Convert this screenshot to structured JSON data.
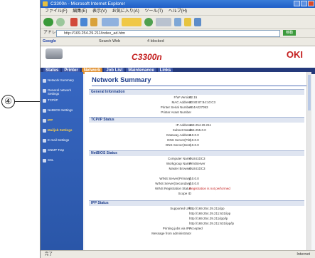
{
  "annotation": {
    "number": "④"
  },
  "window": {
    "title": "C3300n - Microsoft Internet Explorer"
  },
  "menu": [
    "ファイル(F)",
    "編集(E)",
    "表示(V)",
    "お気に入り(A)",
    "ツール(T)",
    "ヘルプ(H)"
  ],
  "address": {
    "label": "アドレス(D)",
    "url": "http://169.254.29.211/index_ad.htm",
    "go_label": "移動"
  },
  "links": {
    "google": "Google",
    "search": "Search Web",
    "blocked": "4 blocked"
  },
  "brand": {
    "model": "C3300n",
    "logo": "OKI"
  },
  "nav": {
    "tabs": [
      "Status",
      "Printer",
      "Network",
      "Job List",
      "Maintenance",
      "Links"
    ]
  },
  "sidebar": {
    "items": [
      {
        "label": "Network Summary"
      },
      {
        "label": "General network Settings"
      },
      {
        "label": "TCP/IP"
      },
      {
        "label": "NetBIOS Settings"
      },
      {
        "label": "IPP"
      },
      {
        "label": "Mailjob Settings"
      },
      {
        "label": "E-mail Settings"
      },
      {
        "label": "SNMP Trap"
      },
      {
        "label": "SSL"
      }
    ]
  },
  "main": {
    "title": "Network Summary",
    "general": {
      "header": "General Information",
      "rows": [
        {
          "k": "F/W Version",
          "v": "02.15"
        },
        {
          "k": "MAC Address",
          "v": "00:80:87:84:10:C3"
        },
        {
          "k": "Printer Serial Number",
          "v": "AE4A027093"
        },
        {
          "k": "Printer Asset Number",
          "v": ""
        }
      ]
    },
    "tcpip": {
      "header": "TCP/IP Status",
      "rows": [
        {
          "k": "IP Address",
          "v": "169.254.29.211"
        },
        {
          "k": "Subnet Mask",
          "v": "255.255.0.0"
        },
        {
          "k": "Gateway Address",
          "v": "0.0.0.0"
        },
        {
          "k": "DNS Server(Pri.)",
          "v": "0.0.0.0"
        },
        {
          "k": "DNS Server(Sec.)",
          "v": "0.0.0.0"
        }
      ]
    },
    "netbios": {
      "header": "NetBIOS Status",
      "rows": [
        {
          "k": "Computer Name",
          "v": "OL841DC3"
        },
        {
          "k": "Workgroup Name",
          "v": "PrintServer"
        },
        {
          "k": "Master Browser",
          "v": "OL841DC3"
        },
        {
          "k": "",
          "v": ""
        },
        {
          "k": "WINS Server(Primary)",
          "v": "0.0.0.0"
        },
        {
          "k": "WINS Server(Secondary)",
          "v": "0.0.0.0"
        },
        {
          "k": "WINS Registration Status",
          "v": "Registration is not performed"
        },
        {
          "k": "Scope ID",
          "v": ""
        }
      ]
    },
    "ipp": {
      "header": "IPP Status",
      "rows": [
        {
          "k": "Supported URI",
          "v": "http://169.254.29.211/ipp"
        },
        {
          "k": "",
          "v": "http://169.254.29.211:631/ipp"
        },
        {
          "k": "",
          "v": "http://169.254.29.211/ipp/lp"
        },
        {
          "k": "",
          "v": "http://169.254.29.211:631/ipp/lp"
        },
        {
          "k": "Printing jobs via IPP",
          "v": "Accepted"
        },
        {
          "k": "Message from administrator",
          "v": ""
        }
      ]
    }
  },
  "statusbar": {
    "left": "完了",
    "right": "Internet"
  }
}
